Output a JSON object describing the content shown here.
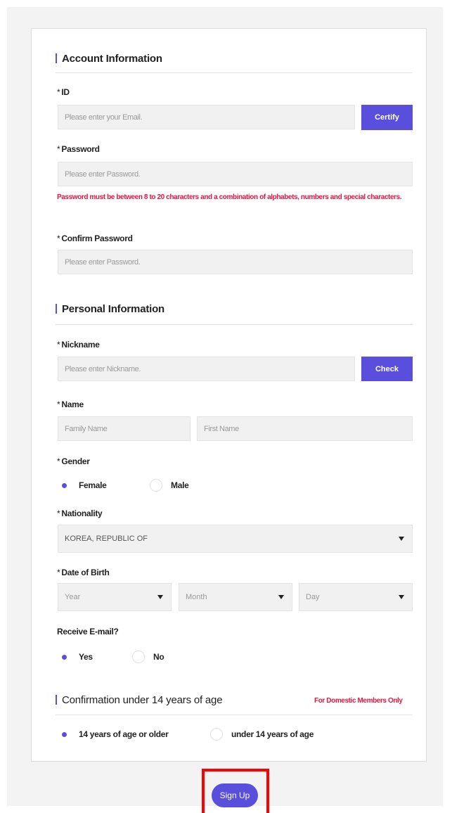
{
  "account": {
    "title": "Account Information",
    "id_label": "ID",
    "id_placeholder": "Please enter your Email.",
    "certify_label": "Certify",
    "password_label": "Password",
    "password_placeholder": "Please enter Password.",
    "password_error": "Password must be between 8 to 20 characters and a combination of alphabets, numbers and special characters.",
    "confirm_label": "Confirm Password",
    "confirm_placeholder": "Please enter Password."
  },
  "personal": {
    "title": "Personal Information",
    "nickname_label": "Nickname",
    "nickname_placeholder": "Please enter Nickname.",
    "check_label": "Check",
    "name_label": "Name",
    "family_placeholder": "Family Name",
    "first_placeholder": "First Name",
    "gender_label": "Gender",
    "gender_options": [
      {
        "label": "Female",
        "selected": true
      },
      {
        "label": "Male",
        "selected": false
      }
    ],
    "nationality_label": "Nationality",
    "nationality_value": "KOREA, REPUBLIC OF",
    "dob_label": "Date of Birth",
    "dob_year": "Year",
    "dob_month": "Month",
    "dob_day": "Day",
    "email_label": "Receive E-mail?",
    "email_options": [
      {
        "label": "Yes",
        "selected": true
      },
      {
        "label": "No",
        "selected": false
      }
    ]
  },
  "age": {
    "title": "Confirmation under 14 years of age",
    "domestic_note": "For Domestic Members Only",
    "options": [
      {
        "label": "14 years of age or older",
        "selected": true
      },
      {
        "label": "under 14 years of age",
        "selected": false
      }
    ]
  },
  "signup_label": "Sign Up",
  "required_mark": "*",
  "colors": {
    "accent": "#5a4fdc",
    "error": "#e2163f",
    "highlight": "#ff0000"
  }
}
